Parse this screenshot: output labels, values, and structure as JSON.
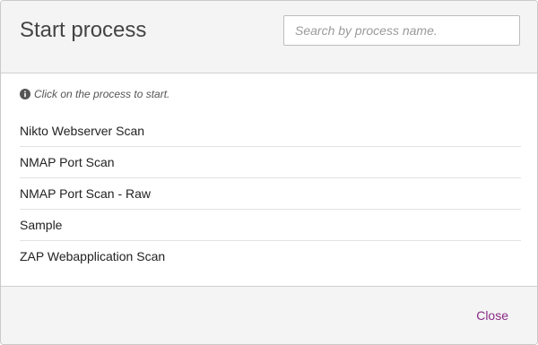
{
  "modal": {
    "title": "Start process",
    "search": {
      "placeholder": "Search by process name.",
      "value": ""
    },
    "hint": "Click on the process to start.",
    "hint_icon": "info-circle-icon",
    "processes": [
      "Nikto Webserver Scan",
      "NMAP Port Scan",
      "NMAP Port Scan - Raw",
      "Sample",
      "ZAP Webapplication Scan"
    ],
    "close_label": "Close",
    "colors": {
      "header_bg": "#f4f4f4",
      "footer_bg": "#f4f4f4",
      "link": "#8a2a86"
    }
  }
}
